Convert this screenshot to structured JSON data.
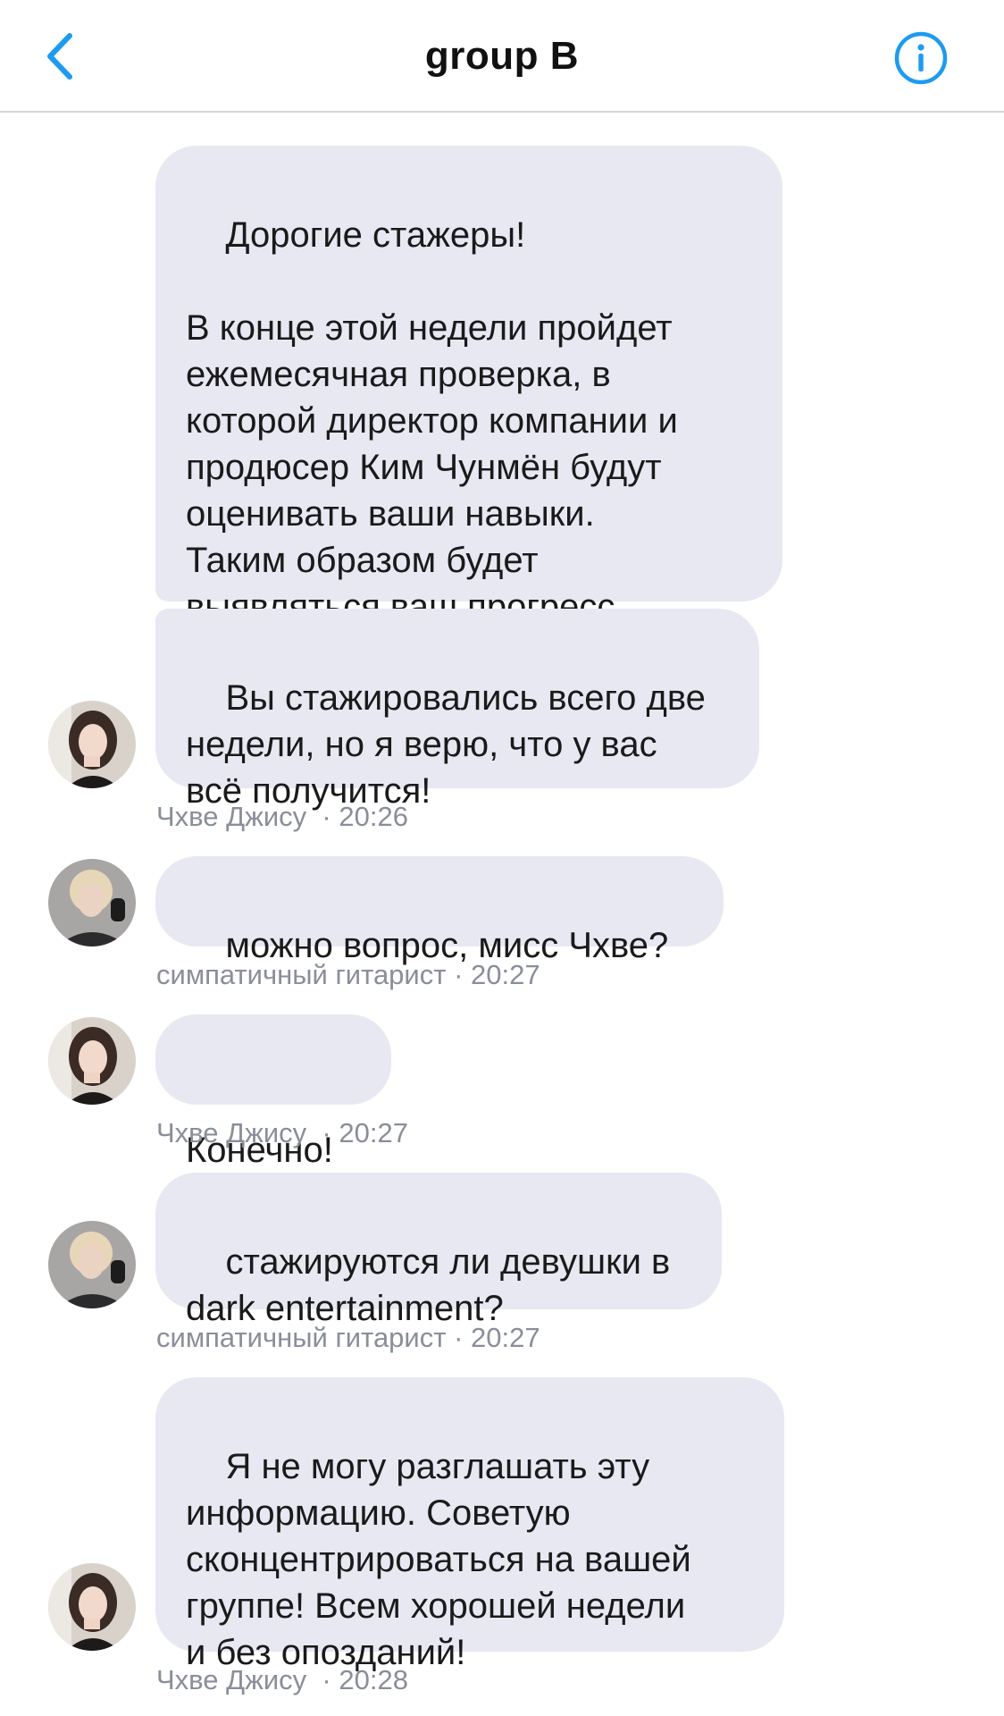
{
  "header": {
    "title": "group B",
    "back_icon": "chevron-left-icon",
    "info_icon": "info-icon"
  },
  "colors": {
    "accent": "#1d9bf0",
    "bubble": "#e8e8f3",
    "meta_text": "#8a8e99"
  },
  "messages": [
    {
      "text": "Дорогие стажеры!\n\nВ конце этой недели пройдет\nежемесячная проверка, в\nкоторой директор компании и\nпродюсер Ким Чунмён будут\nоценивать ваши навыки.\nТаким образом будет\nвыявляться ваш прогресс"
    },
    {
      "text": "Вы стажировались всего две\nнедели, но я верю, что у вас\nвсё получится!",
      "sender": "Чхве Джису",
      "time": "· 20:26"
    },
    {
      "text": "можно вопрос, мисс Чхве?",
      "sender": "симпатичный гитарист",
      "time": "· 20:27"
    },
    {
      "text": "Конечно!",
      "sender": "Чхве Джису",
      "time": "· 20:27"
    },
    {
      "text": "стажируются ли девушки в\ndark entertainment?",
      "sender": "симпатичный гитарист",
      "time": "· 20:27"
    },
    {
      "text": "Я не могу разглашать эту\nинформацию. Советую\nсконцентрироваться на вашей\nгруппе! Всем хорошей недели\nи без опозданий!",
      "sender": "Чхве Джису",
      "time": "· 20:28"
    }
  ]
}
